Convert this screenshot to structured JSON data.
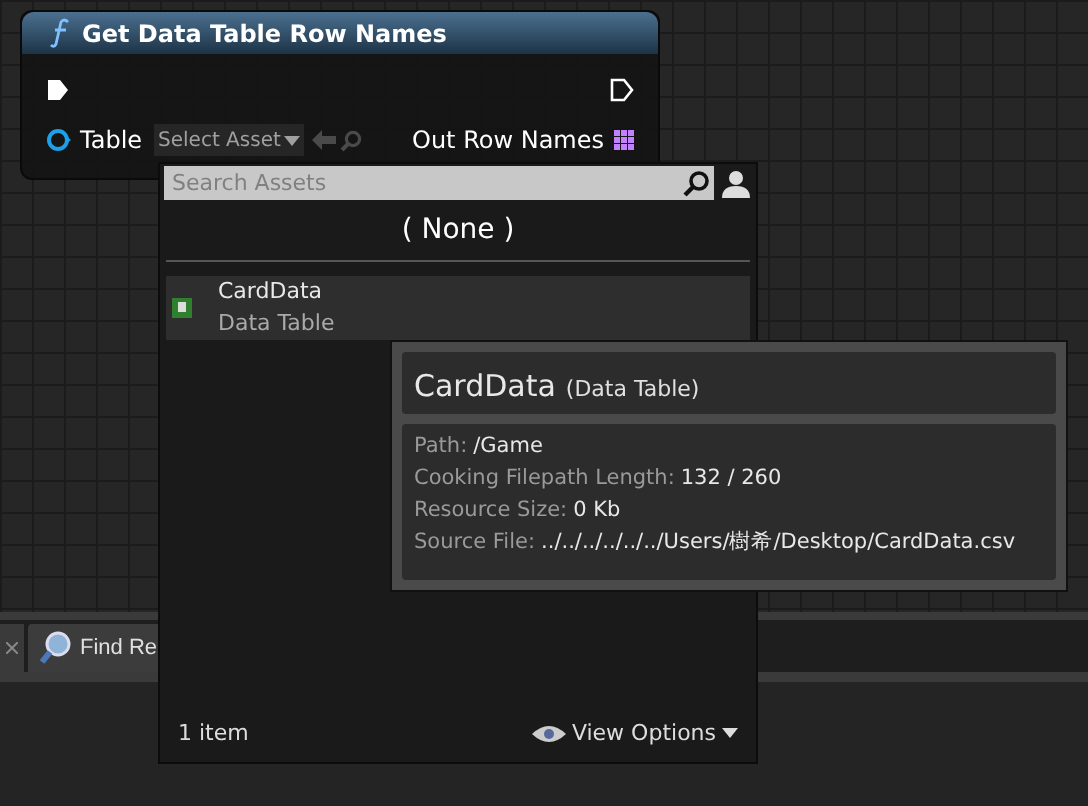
{
  "node": {
    "title": "Get Data Table Row Names",
    "input_pin": "Table",
    "asset_picker": "Select Asset",
    "output_pin": "Out Row Names"
  },
  "asset_popup": {
    "search": {
      "placeholder": "Search Assets"
    },
    "none_option": "( None )",
    "items": [
      {
        "name": "CardData",
        "type": "Data Table",
        "highlighted": true
      }
    ],
    "count": "1 item",
    "view_options": "View Options"
  },
  "tooltip": {
    "title": "CardData",
    "type": "(Data Table)",
    "details": [
      {
        "label": "Path:",
        "value": "/Game"
      },
      {
        "label": "Cooking Filepath Length:",
        "value": "132 / 260"
      },
      {
        "label": "Resource Size:",
        "value": "0 Kb"
      },
      {
        "label": "Source File:",
        "value": "../../../../../../Users/樹希/Desktop/CardData.csv"
      }
    ]
  },
  "bottom_panel": {
    "tabs": [
      {
        "label": "Find Re"
      }
    ]
  }
}
